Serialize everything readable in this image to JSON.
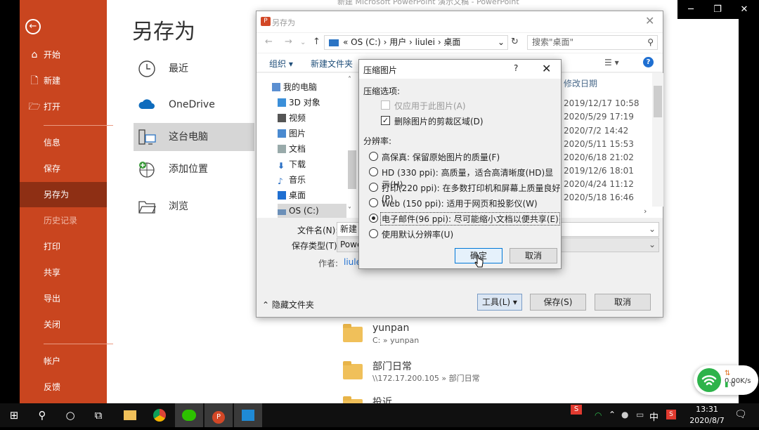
{
  "backstage": {
    "title": "另存为",
    "powerpoint_title": "新建 Microsoft PowerPoint 演示文稿 - PowerPoint",
    "nav_top": [
      {
        "icon": "home-icon",
        "label": "开始"
      },
      {
        "icon": "new-file-icon",
        "label": "新建"
      },
      {
        "icon": "open-folder-icon",
        "label": "打开"
      }
    ],
    "nav_main": [
      "信息",
      "保存",
      "另存为",
      "历史记录",
      "打印",
      "共享",
      "导出",
      "关闭"
    ],
    "nav_bottom": [
      "帐户",
      "反馈"
    ],
    "active_item": "另存为",
    "locations": [
      {
        "icon": "clock-icon",
        "label": "最近"
      },
      {
        "icon": "cloud-icon",
        "label": "OneDrive"
      },
      {
        "icon": "computer-icon",
        "label": "这台电脑"
      },
      {
        "icon": "add-place-icon",
        "label": "添加位置"
      },
      {
        "icon": "browse-folder-icon",
        "label": "浏览"
      }
    ],
    "folders": [
      {
        "name": "yunpan",
        "path": "C: » yunpan"
      },
      {
        "name": "部门日常",
        "path": "\\\\172.17.200.105 » 部门日常"
      },
      {
        "name": "投近",
        "path": ""
      }
    ]
  },
  "save_dialog": {
    "title": "另存为",
    "path": "« OS (C:)  ›  用户  ›  liulei  ›  桌面",
    "search_placeholder": "搜索\"桌面\"",
    "toolbar_organize": "组织 ▾",
    "toolbar_new_folder": "新建文件夹",
    "column_modified": "修改日期",
    "nav_tree": [
      {
        "label": "我的电脑",
        "icon": "computer-icon"
      },
      {
        "label": "3D 对象",
        "icon": "3d-objects-icon"
      },
      {
        "label": "视频",
        "icon": "video-icon"
      },
      {
        "label": "图片",
        "icon": "pictures-icon"
      },
      {
        "label": "文档",
        "icon": "documents-icon"
      },
      {
        "label": "下载",
        "icon": "download-icon"
      },
      {
        "label": "音乐",
        "icon": "music-icon"
      },
      {
        "label": "桌面",
        "icon": "desktop-icon"
      },
      {
        "label": "OS (C:)",
        "icon": "drive-icon"
      }
    ],
    "dates": [
      "2019/12/17 10:58",
      "2020/5/29 17:19",
      "2020/7/2 14:42",
      "2020/5/11 15:53",
      "2020/6/18 21:02",
      "2019/12/6 18:01",
      "2020/4/24 11:12",
      "2020/5/18 16:46"
    ],
    "filename_label": "文件名(N):",
    "filename_value": "新建",
    "filetype_label": "保存类型(T):",
    "filetype_value": "Powe",
    "author_label": "作者:",
    "author_value": "liule",
    "hide_folders": "隐藏文件夹",
    "tools_button": "工具(L)",
    "save_button": "保存(S)",
    "cancel_button": "取消"
  },
  "compress_dialog": {
    "title": "压缩图片",
    "help": "?",
    "options_label": "压缩选项:",
    "option_apply_only": "仅应用于此图片(A)",
    "option_apply_only_checked": false,
    "option_delete_cropped": "删除图片的剪裁区域(D)",
    "option_delete_cropped_checked": true,
    "resolution_label": "分辨率:",
    "resolutions": [
      "高保真: 保留原始图片的质量(F)",
      "HD (330 ppi): 高质量，适合高清晰度(HD)显示(H)",
      "打印(220 ppi): 在多数打印机和屏幕上质量良好(P)",
      "Web (150 ppi): 适用于网页和投影仪(W)",
      "电子邮件(96 ppi): 尽可能缩小文档以便共享(E)",
      "使用默认分辨率(U)"
    ],
    "selected_resolution": 4,
    "ok_button": "确定",
    "cancel_button": "取消"
  },
  "network_widget": {
    "upload": "0.00K/s",
    "download": "0"
  },
  "taskbar": {
    "time": "13:31",
    "date": "2020/8/7",
    "ime": "中",
    "apps": [
      "start-icon",
      "search-icon",
      "cortana-icon",
      "task-view-icon",
      "file-explorer-icon",
      "chrome-icon",
      "wechat-icon",
      "powerpoint-icon",
      "media-app-icon"
    ]
  },
  "colors": {
    "accent": "#c9451f",
    "active": "#8e2f14",
    "taskbar": "#101010"
  }
}
